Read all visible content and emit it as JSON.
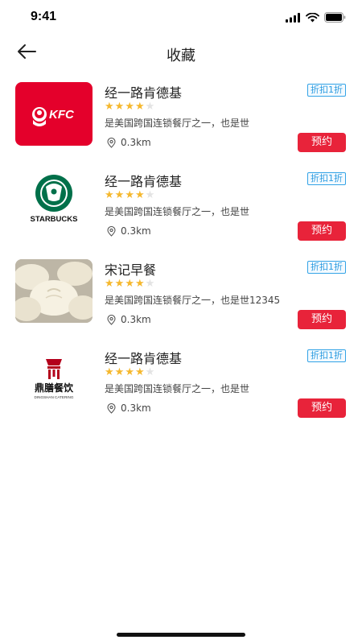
{
  "status": {
    "time": "9:41"
  },
  "header": {
    "title": "收藏",
    "back_icon": "arrow-left-icon"
  },
  "colors": {
    "accent": "#e8233a",
    "discount": "#2b9be0",
    "star": "#f5b82e"
  },
  "items": [
    {
      "name": "经一路肯德基",
      "discount": "折扣1折",
      "rating": 4,
      "rating_max": 5,
      "desc": "是美国跨国连锁餐厅之一，也是世",
      "distance": "0.3km",
      "action": "预约",
      "logo": "kfc-logo",
      "logo_text": "KFC"
    },
    {
      "name": "经一路肯德基",
      "discount": "折扣1折",
      "rating": 4,
      "rating_max": 5,
      "desc": "是美国跨国连锁餐厅之一，也是世",
      "distance": "0.3km",
      "action": "预约",
      "logo": "starbucks-logo",
      "logo_text": "STARBUCKS"
    },
    {
      "name": "宋记早餐",
      "discount": "折扣1折",
      "rating": 4,
      "rating_max": 5,
      "desc": "是美国跨国连锁餐厅之一，也是世12345",
      "distance": "0.3km",
      "action": "预约",
      "logo": "steamed-buns-photo"
    },
    {
      "name": "经一路肯德基",
      "discount": "折扣1折",
      "rating": 4,
      "rating_max": 5,
      "desc": "是美国跨国连锁餐厅之一，也是世",
      "distance": "0.3km",
      "action": "预约",
      "logo": "dingshan-catering-logo",
      "logo_text": "鼎膳餐饮",
      "logo_subtext": "DINGSHAN CATERING"
    }
  ]
}
